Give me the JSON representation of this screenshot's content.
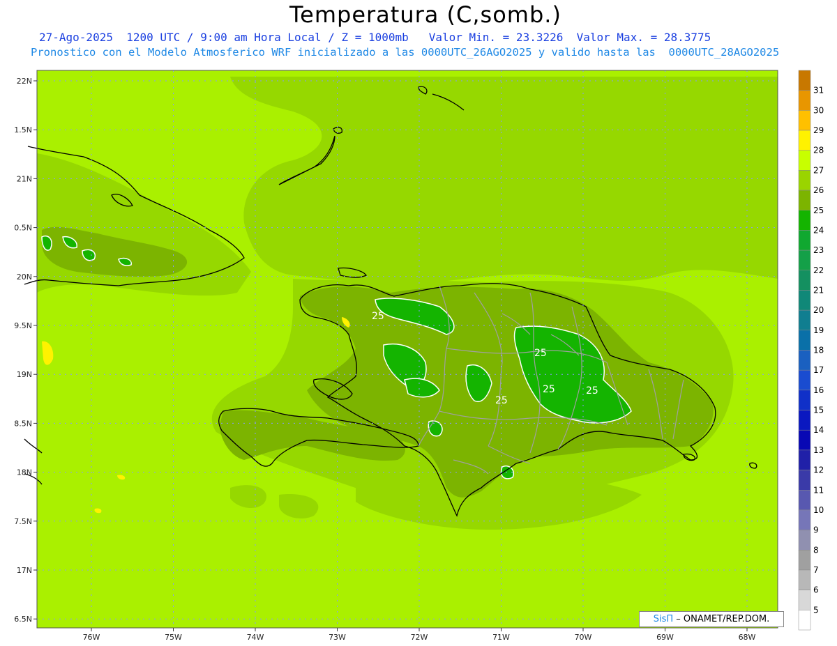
{
  "title": "Temperatura (C,somb.)",
  "subtitle_line1": "27-Ago-2025  1200 UTC / 9:00 am Hora Local / Z = 1000mb   Valor Min. = 23.3226  Valor Max. = 28.3775",
  "subtitle_line2": "Pronostico con el Modelo Atmosferico WRF inicializado a las 0000UTC_26AGO2025 y valido hasta las  0000UTC_28AGO2025",
  "credit": {
    "brand": "SisΠ",
    "text": "– ONAMET/REP.DOM."
  },
  "axes": {
    "lon_labels": [
      "76W",
      "75W",
      "74W",
      "73W",
      "72W",
      "71W",
      "70W",
      "69W",
      "68W"
    ],
    "lat_labels": [
      "22N",
      "1.5N",
      "21N",
      "0.5N",
      "20N",
      "9.5N",
      "19N",
      "8.5N",
      "18N",
      "7.5N",
      "17N",
      "6.5N"
    ]
  },
  "contour_labels": [
    "25",
    "25",
    "25",
    "25",
    "25"
  ],
  "colorbar": {
    "labels": [
      "31",
      "30",
      "29",
      "28",
      "27",
      "26",
      "25",
      "24",
      "23",
      "22",
      "21",
      "20",
      "19",
      "18",
      "17",
      "16",
      "15",
      "14",
      "13",
      "12",
      "11",
      "10",
      "9",
      "8",
      "7",
      "6",
      "5"
    ],
    "colors": [
      "#c87800",
      "#e89600",
      "#ffc000",
      "#fff200",
      "#c8ff00",
      "#9ad400",
      "#7cb400",
      "#14b400",
      "#10a830",
      "#14a048",
      "#149060",
      "#108878",
      "#107e90",
      "#0a70a8",
      "#1a60c0",
      "#1a4cd0",
      "#1030c8",
      "#0a18c0",
      "#0808b4",
      "#2020a8",
      "#3a3aa8",
      "#5858b0",
      "#7676b8",
      "#9090b0",
      "#a0a0a0",
      "#b8b8b8",
      "#d8d8d8",
      "#ffffff"
    ]
  }
}
